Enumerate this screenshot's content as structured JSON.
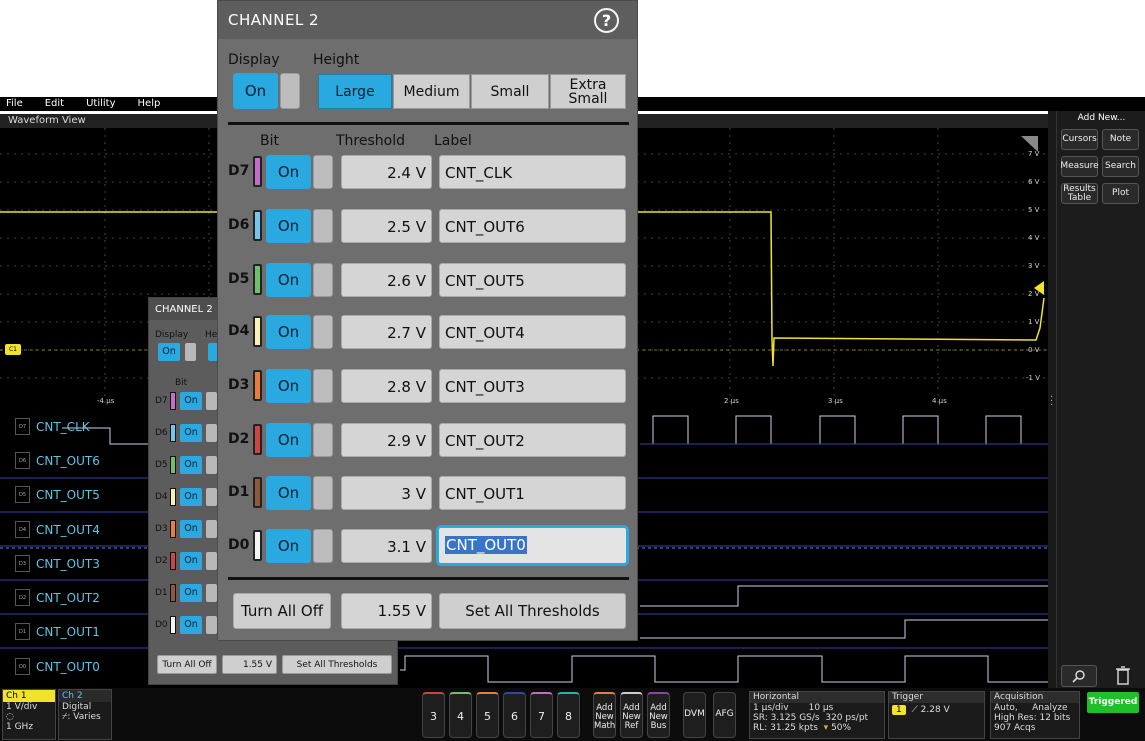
{
  "menu": {
    "items": [
      "File",
      "Edit",
      "Utility",
      "Help"
    ]
  },
  "waveform_view": {
    "title": "Waveform View",
    "ch1_marker": "C1"
  },
  "y_ticks": [
    "7 V",
    "6 V",
    "5 V",
    "4 V",
    "3 V",
    "2 V",
    "1 V",
    "0 V",
    "-1 V"
  ],
  "x_ticks": [
    "-4 µs",
    "2 µs",
    "3 µs",
    "4 µs"
  ],
  "digital_rows": [
    {
      "tag": "D7",
      "label": "CNT_CLK"
    },
    {
      "tag": "D6",
      "label": "CNT_OUT6"
    },
    {
      "tag": "D5",
      "label": "CNT_OUT5"
    },
    {
      "tag": "D4",
      "label": "CNT_OUT4"
    },
    {
      "tag": "D3",
      "label": "CNT_OUT3"
    },
    {
      "tag": "D2",
      "label": "CNT_OUT2"
    },
    {
      "tag": "D1",
      "label": "CNT_OUT1"
    },
    {
      "tag": "D0",
      "label": "CNT_OUT0"
    }
  ],
  "add_new": {
    "title": "Add New...",
    "buttons": [
      "Cursors",
      "Note",
      "Measure",
      "Search",
      "Results Table",
      "Plot"
    ]
  },
  "dialog": {
    "title": "CHANNEL 2",
    "help": "?",
    "display_label": "Display",
    "height_label": "Height",
    "display_value": "On",
    "heights": [
      "Large",
      "Medium",
      "Small",
      "Extra Small"
    ],
    "col_bit": "Bit",
    "col_threshold": "Threshold",
    "col_label": "Label",
    "rows": [
      {
        "bit": "D7",
        "state": "On",
        "threshold": "2.4 V",
        "label": "CNT_CLK",
        "color": "#c46cc6"
      },
      {
        "bit": "D6",
        "state": "On",
        "threshold": "2.5 V",
        "label": "CNT_OUT6",
        "color": "#74c7ec"
      },
      {
        "bit": "D5",
        "state": "On",
        "threshold": "2.6 V",
        "label": "CNT_OUT5",
        "color": "#6fbf6f"
      },
      {
        "bit": "D4",
        "state": "On",
        "threshold": "2.7 V",
        "label": "CNT_OUT4",
        "color": "#f6f0b5"
      },
      {
        "bit": "D3",
        "state": "On",
        "threshold": "2.8 V",
        "label": "CNT_OUT3",
        "color": "#e77d3c"
      },
      {
        "bit": "D2",
        "state": "On",
        "threshold": "2.9 V",
        "label": "CNT_OUT2",
        "color": "#cc4444"
      },
      {
        "bit": "D1",
        "state": "On",
        "threshold": "3 V",
        "label": "CNT_OUT1",
        "color": "#8b5a3c"
      },
      {
        "bit": "D0",
        "state": "On",
        "threshold": "3.1 V",
        "label": "CNT_OUT0",
        "color": "#f4f4f4"
      }
    ],
    "turn_all_off": "Turn All Off",
    "all_threshold": "1.55 V",
    "set_all": "Set All Thresholds"
  },
  "dialog_small": {
    "title": "CHANNEL 2",
    "display_label": "Display",
    "height_label": "He",
    "display_value": "On",
    "bit_label": "Bit",
    "turn_all_off": "Turn All Off",
    "all_threshold": "1.55 V",
    "set_all": "Set All Thresholds"
  },
  "bottom": {
    "ch1": {
      "name": "Ch 1",
      "scale": "1 V/div",
      "bw": "1 GHz"
    },
    "ch2": {
      "name": "Ch 2",
      "type": "Digital",
      "varies": "⌿: Varies"
    },
    "channel_buttons": [
      "3",
      "4",
      "5",
      "6",
      "7",
      "8"
    ],
    "add_buttons": [
      "Add New Math",
      "Add New Ref",
      "Add New Bus"
    ],
    "dvm": "DVM",
    "afg": "AFG",
    "horizontal": {
      "title": "Horizontal",
      "line1a": "1 µs/div",
      "line1b": "10 µs",
      "line2a": "SR: 3.125 GS/s",
      "line2b": "320 ps/pt",
      "line3a": "RL: 31.25 kpts",
      "line3b": "50%"
    },
    "trigger": {
      "title": "Trigger",
      "ch": "1",
      "level": "2.28 V"
    },
    "acquisition": {
      "title": "Acquisition",
      "line1a": "Auto,",
      "line1b": "Analyze",
      "line2": "High Res: 12 bits",
      "line3": "907 Acqs"
    },
    "status": "Triggered"
  },
  "colors": {
    "ch1": "#f1e32b",
    "digital": "#5ac6e8",
    "on": "#2aa9e0",
    "triggered": "#1fbf2a"
  }
}
